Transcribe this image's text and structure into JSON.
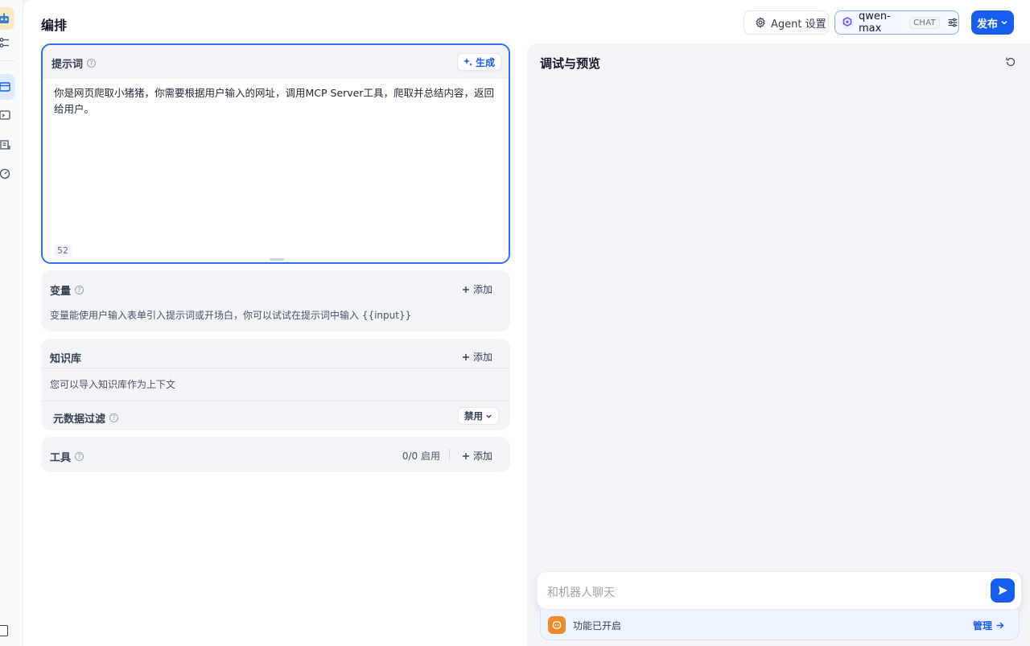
{
  "header": {
    "title": "编排",
    "agent_settings_label": "Agent 设置",
    "model_name": "qwen-max",
    "model_mode": "CHAT",
    "publish_label": "发布"
  },
  "prompt": {
    "label": "提示词",
    "generate_label": "生成",
    "text": "你是网页爬取小猪猪，你需要根据用户输入的网址，调用MCP Server工具，爬取并总结内容，返回给用户。",
    "char_count": "52"
  },
  "variables": {
    "title": "变量",
    "add_label": "添加",
    "description": "变量能使用户输入表单引入提示词或开场白，你可以试试在提示词中输入 {{input}}"
  },
  "knowledge": {
    "title": "知识库",
    "add_label": "添加",
    "description": "您可以导入知识库作为上下文",
    "metadata_filter_label": "元数据过滤",
    "metadata_filter_value": "禁用"
  },
  "tools": {
    "title": "工具",
    "count": "0/0 启用",
    "add_label": "添加"
  },
  "preview": {
    "title": "调试与预览",
    "chat_placeholder": "和机器人聊天",
    "features_label": "功能已开启",
    "manage_label": "管理"
  },
  "colors": {
    "accent": "#155eef",
    "feature_icon": "#ef8a2a"
  }
}
